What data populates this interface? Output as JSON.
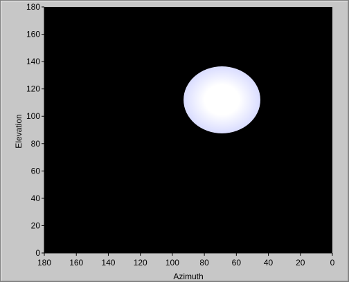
{
  "chart_data": {
    "type": "heatmap",
    "title": "",
    "xlabel": "Azimuth",
    "ylabel": "Elevation",
    "xlim": [
      180,
      0
    ],
    "ylim": [
      0,
      180
    ],
    "x_reversed": true,
    "x_ticks": [
      180,
      160,
      140,
      120,
      100,
      80,
      60,
      40,
      20,
      0
    ],
    "y_ticks": [
      0,
      20,
      40,
      60,
      80,
      100,
      120,
      140,
      160,
      180
    ],
    "grid": false,
    "background_color": "#000000",
    "blob": {
      "azimuth_center": 69,
      "elevation_center": 112,
      "azimuth_left": 91,
      "azimuth_right": 43,
      "elevation_top": 137,
      "elevation_bottom": 88,
      "color_center": "#ffffff",
      "color_edge": "#d9dcff"
    }
  }
}
